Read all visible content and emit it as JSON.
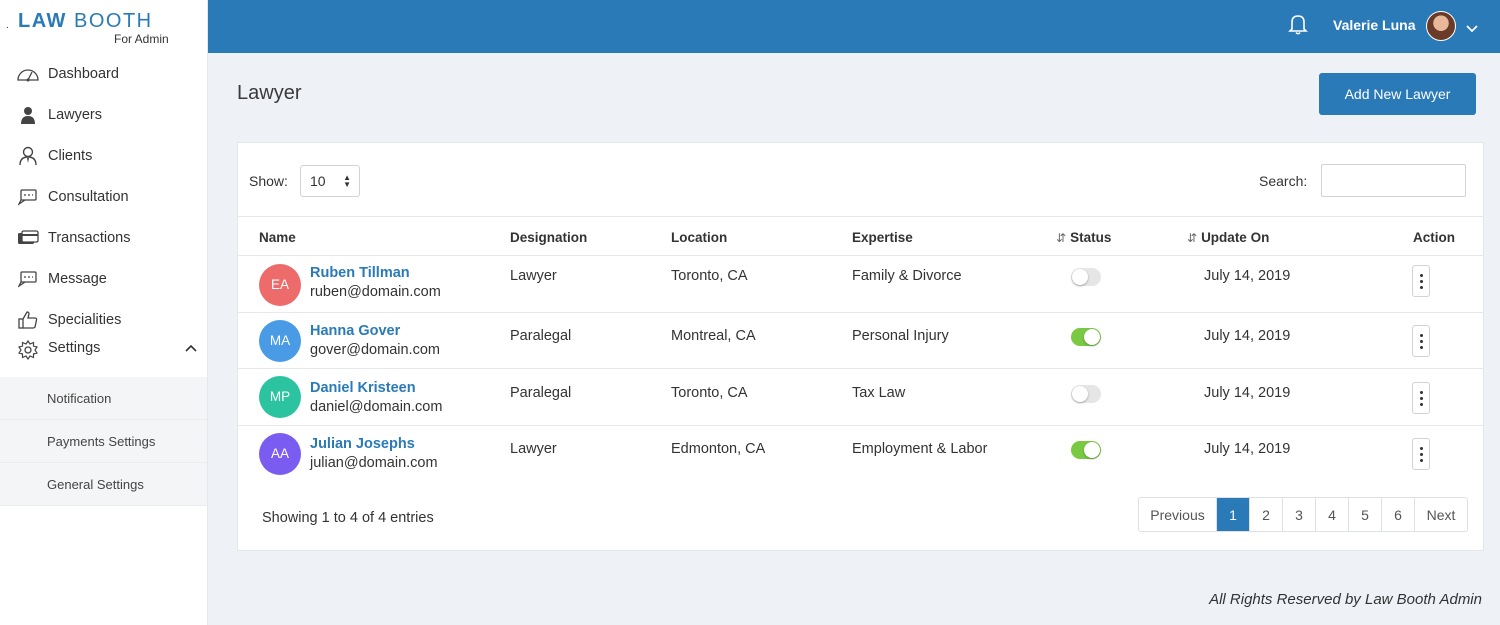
{
  "brand": {
    "name_bold": "LAW",
    "name_rest": "BOOTH",
    "subtitle": "For Admin",
    "accent": "#2a7ab8"
  },
  "sidebar": {
    "items": [
      {
        "label": "Dashboard",
        "icon": "dashboard-icon"
      },
      {
        "label": "Lawyers",
        "icon": "lawyer-icon"
      },
      {
        "label": "Clients",
        "icon": "client-icon"
      },
      {
        "label": "Consultation",
        "icon": "consultation-icon"
      },
      {
        "label": "Transactions",
        "icon": "transactions-icon"
      },
      {
        "label": "Message",
        "icon": "message-icon"
      },
      {
        "label": "Specialities",
        "icon": "thumbs-up-icon"
      },
      {
        "label": "Settings",
        "icon": "gear-icon"
      }
    ],
    "settings_sub": [
      "Notification",
      "Payments Settings",
      "General Settings"
    ]
  },
  "header": {
    "user_name": "Valerie Luna"
  },
  "page": {
    "title": "Lawyer",
    "add_button": "Add New Lawyer"
  },
  "table": {
    "show_label": "Show:",
    "page_size": "10",
    "search_label": "Search:",
    "search_value": "",
    "columns": [
      "Name",
      "Designation",
      "Location",
      "Expertise",
      "Status",
      "Update On",
      "Action"
    ],
    "rows": [
      {
        "initials": "EA",
        "color": "#ee6b6b",
        "name": "Ruben Tillman",
        "email": "ruben@domain.com",
        "designation": "Lawyer",
        "location": "Toronto, CA",
        "expertise": "Family & Divorce",
        "status": "off",
        "updated": "July 14, 2019"
      },
      {
        "initials": "MA",
        "color": "#4a9be6",
        "name": "Hanna Gover",
        "email": "gover@domain.com",
        "designation": "Paralegal",
        "location": "Montreal, CA",
        "expertise": "Personal Injury",
        "status": "on",
        "updated": "July 14, 2019"
      },
      {
        "initials": "MP",
        "color": "#2cc4a0",
        "name": "Daniel Kristeen",
        "email": "daniel@domain.com",
        "designation": "Paralegal",
        "location": "Toronto, CA",
        "expertise": "Tax Law",
        "status": "off",
        "updated": "July 14, 2019"
      },
      {
        "initials": "AA",
        "color": "#7a5cf0",
        "name": "Julian Josephs",
        "email": "julian@domain.com",
        "designation": "Lawyer",
        "location": "Edmonton, CA",
        "expertise": "Employment & Labor",
        "status": "on",
        "updated": "July 14, 2019"
      }
    ],
    "entries_text": "Showing 1 to 4 of 4 entries",
    "pagination": [
      "Previous",
      "1",
      "2",
      "3",
      "4",
      "5",
      "6",
      "Next"
    ],
    "active_page": "1"
  },
  "footer": {
    "text": "All Rights Reserved by Law Booth Admin"
  }
}
